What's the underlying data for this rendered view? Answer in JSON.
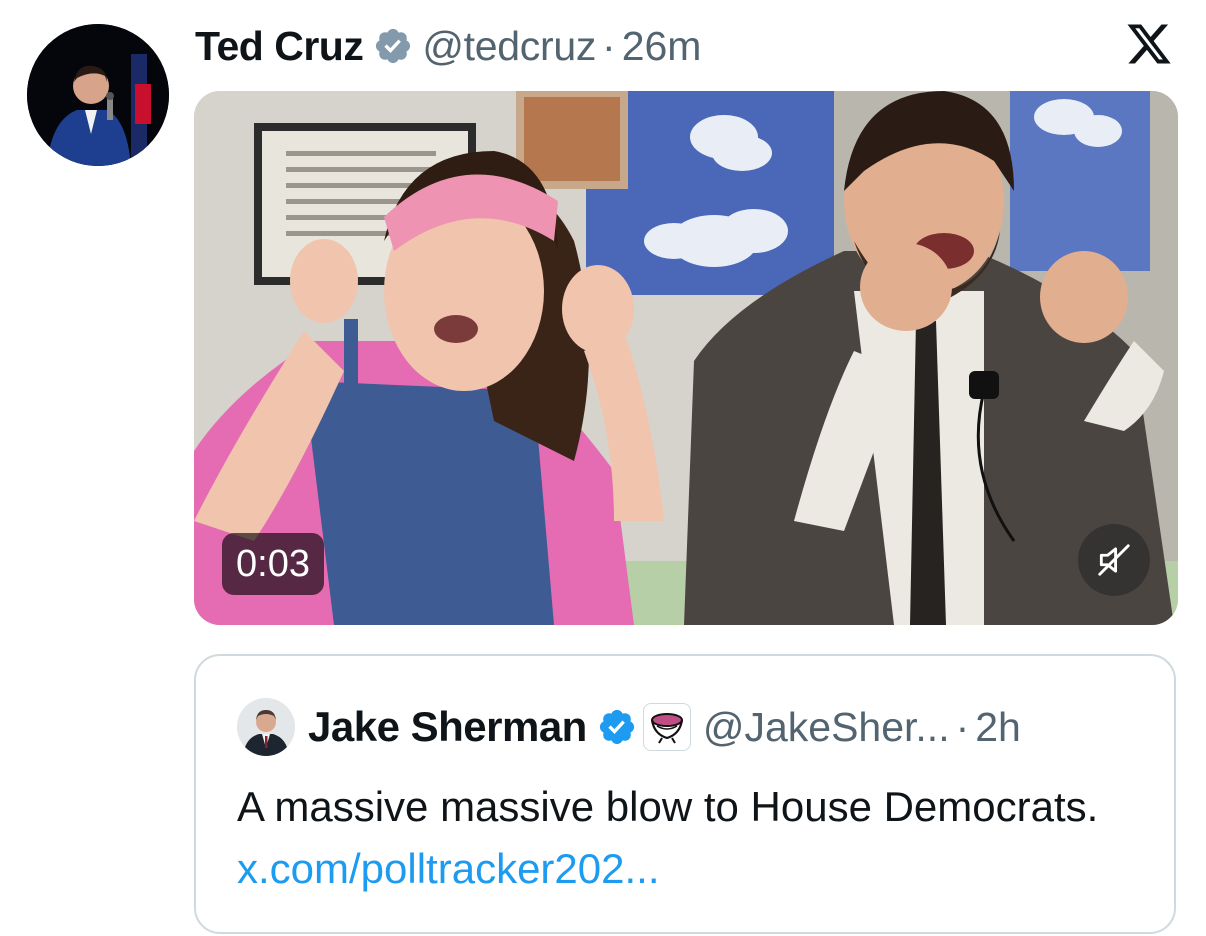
{
  "tweet": {
    "author_name": "Ted Cruz",
    "handle": "@tedcruz",
    "separator": "·",
    "time": "26m",
    "verified_icon": "verified-badge-icon",
    "avatar_icon": "profile-avatar"
  },
  "media": {
    "duration": "0:03",
    "mute_icon": "muted-speaker-icon"
  },
  "platform_logo_icon": "x-logo-icon",
  "quote": {
    "author_name": "Jake Sherman",
    "handle": "@JakeSher...",
    "separator": "·",
    "time": "2h",
    "verified_icon": "verified-badge-icon",
    "affiliate_badge_icon": "affiliate-org-badge-icon",
    "text": "A massive massive blow to House Democrats.",
    "link_text": "x.com/polltracker202..."
  },
  "colors": {
    "verified_blue": "#1d9bf0",
    "secondary_text": "#536471",
    "primary_text": "#0f1419",
    "border": "#cfd9de"
  }
}
